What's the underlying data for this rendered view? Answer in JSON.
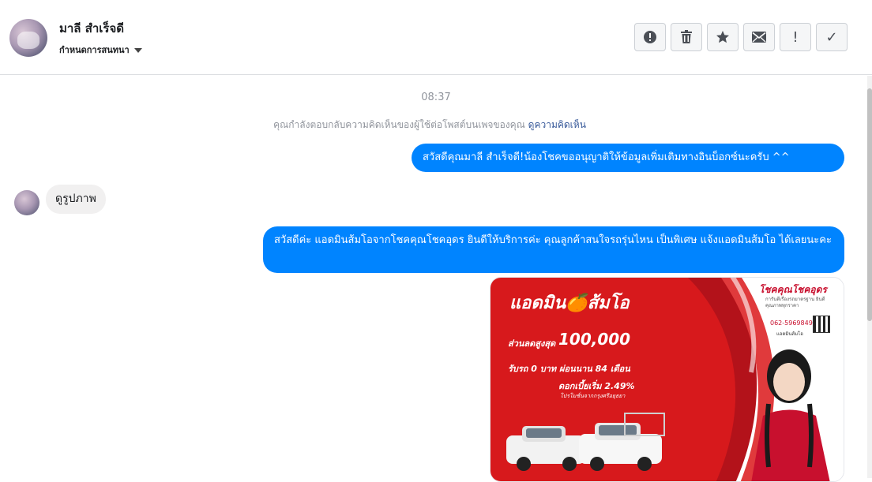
{
  "header": {
    "contact_name": "มาลี สำเร็จดี",
    "status_select": "กำหนดการสนทนา",
    "actions": [
      {
        "name": "report-button",
        "icon": "alert-circle-icon"
      },
      {
        "name": "delete-button",
        "icon": "trash-icon"
      },
      {
        "name": "star-button",
        "icon": "star-icon"
      },
      {
        "name": "mark-unread-button",
        "icon": "envelope-icon"
      },
      {
        "name": "mark-important-button",
        "icon": "exclamation-icon",
        "glyph": "!"
      },
      {
        "name": "mark-done-button",
        "icon": "check-icon",
        "glyph": "✓"
      }
    ]
  },
  "conversation": {
    "time": "08:37",
    "notice_text": "คุณกำลังตอบกลับความคิดเห็นของผู้ใช้ต่อโพสต์บนเพจของคุณ",
    "notice_link": "ดูความคิดเห็น",
    "messages": [
      {
        "direction": "outgoing",
        "text": "สวัสดีคุณมาลี สำเร็จดี!น้องโชคขออนุญาติให้ข้อมูลเพิ่มเติมทางอินบ็อกซ์นะครับ ^^"
      },
      {
        "direction": "incoming",
        "text": "ดูรูปภาพ"
      },
      {
        "direction": "outgoing",
        "text": "สวัสดีค่ะ แอดมินส้มโอจากโชคคุณโชคอุดร ยินดีให้บริการค่ะ   คุณลูกค้าสนใจรถรุ่นไหน เป็นพิเศษ แจ้งแอดมินส้มโอ ได้เลยนะคะ"
      }
    ],
    "ad_image": {
      "title": "แอดมิน🍊ส้มโอ",
      "line1_label": "ส่วนลดสูงสุด",
      "line1_value": "100,000",
      "line2": "รับรถ 0 บาท ผ่อนนาน 84 เดือน",
      "line3": "ดอกเบี้ยเริ่ม 2.49%",
      "line4": "โปรโมชั่นจากกรุงศรีอยุธยา",
      "brand": "โชคคุณโชคอุดร",
      "brand_sub": "การันตีเรื่องรถมาตรฐาน ยินดีคุณภาพทุกราคา",
      "phone": "062-5969849",
      "phone_sub": "แอดมินส้มโอ"
    }
  },
  "colors": {
    "accent": "#0084ff",
    "ad_red": "#d7191c",
    "header_border": "#dddfe2"
  }
}
